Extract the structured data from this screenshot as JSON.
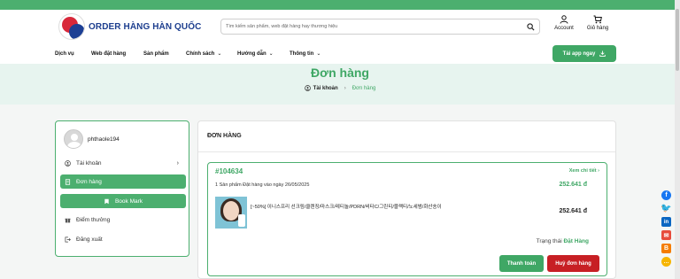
{
  "brand": {
    "name": "ORDER HÀNG HÀN QUỐC"
  },
  "search": {
    "placeholder": "Tìm kiếm sản phẩm, web đặt hàng hay thương hiệu"
  },
  "header_icons": {
    "account": "Account",
    "cart": "Giỏ hàng"
  },
  "nav": {
    "items": [
      {
        "label": "Dịch vụ",
        "dropdown": false
      },
      {
        "label": "Web đặt hàng",
        "dropdown": false
      },
      {
        "label": "Sản phẩm",
        "dropdown": false
      },
      {
        "label": "Chính sách",
        "dropdown": true
      },
      {
        "label": "Hướng dẫn",
        "dropdown": true
      },
      {
        "label": "Thông tin",
        "dropdown": true
      }
    ],
    "app_button": "Tải app ngay"
  },
  "banner": {
    "title": "Đơn hàng",
    "breadcrumb_home": "Tài khoản",
    "breadcrumb_current": "Đơn hàng"
  },
  "sidebar": {
    "username": "phthaole194",
    "items": [
      {
        "label": "Tài khoản",
        "icon": "user-icon"
      },
      {
        "label": "Đơn hàng",
        "icon": "document-icon"
      },
      {
        "label": "Book Mark",
        "icon": "bookmark-icon"
      },
      {
        "label": "Điểm thưởng",
        "icon": "gift-icon"
      },
      {
        "label": "Đăng xuất",
        "icon": "logout-icon"
      }
    ]
  },
  "orders": {
    "title": "ĐƠN HÀNG",
    "order": {
      "id": "#104634",
      "detail_link": "Xem chi tiết",
      "meta": "1 Sản phẩm  Đặt hàng vào ngày 26/05/2025",
      "total": "252.641 đ",
      "product_name": "[~50%] 이니스프리 선크림/클렌징/마스크/레티놀/PDRN/비타C/그린티/블랙티/노세범/화산송이",
      "product_price": "252.641 đ",
      "status_label": "Trạng thái",
      "status_value": "Đặt Hàng",
      "pay_button": "Thanh toán",
      "cancel_button": "Huỷ đơn hàng"
    }
  },
  "colors": {
    "accent": "#4caf6f",
    "danger": "#c71f24",
    "banner_bg": "#e7f4ef"
  },
  "social_icons": [
    "facebook-icon",
    "twitter-icon",
    "linkedin-icon",
    "email-icon",
    "blogger-icon",
    "chat-icon"
  ]
}
